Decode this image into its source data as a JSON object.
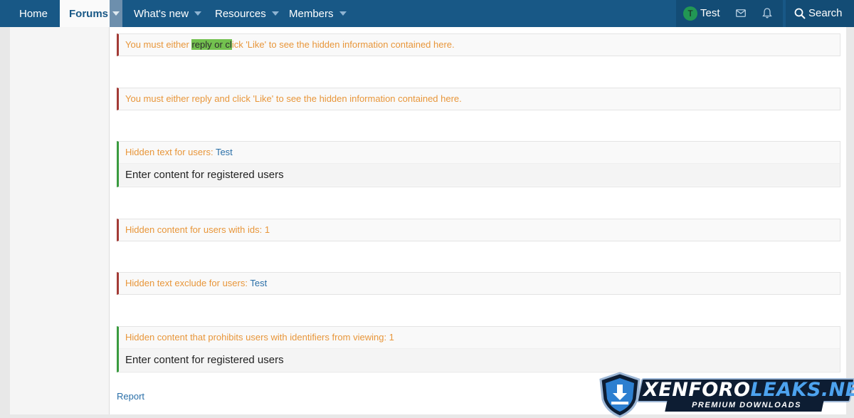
{
  "nav": {
    "home": "Home",
    "forums": "Forums",
    "whats_new": "What's new",
    "resources": "Resources",
    "members": "Members",
    "user_initial": "T",
    "username": "Test",
    "search": "Search"
  },
  "blocks": [
    {
      "prefix": "You must either ",
      "highlight": "reply or cl",
      "suffix": "ick 'Like' to see the hidden information contained here."
    },
    {
      "text": "You must either reply and click 'Like' to see the hidden information contained here."
    },
    {
      "label": "Hidden text for users: ",
      "user": "Test",
      "content": "Enter content for registered users"
    },
    {
      "text": "Hidden content for users with ids: 1"
    },
    {
      "label": "Hidden text exclude for users: ",
      "user": "Test"
    },
    {
      "text": "Hidden content that prohibits users with identifiers from viewing: 1",
      "content": "Enter content for registered users"
    }
  ],
  "report": "Report",
  "watermark": {
    "brand_a": "XENFORO",
    "brand_b": "LEAKS.NET",
    "tagline": "PREMIUM DOWNLOADS"
  },
  "colors": {
    "nav_bg": "#185886",
    "accent_orange": "#e8963a",
    "link_blue": "#2a6fa8",
    "red_bar": "#a33b36",
    "green_bar": "#3a9b3f"
  }
}
